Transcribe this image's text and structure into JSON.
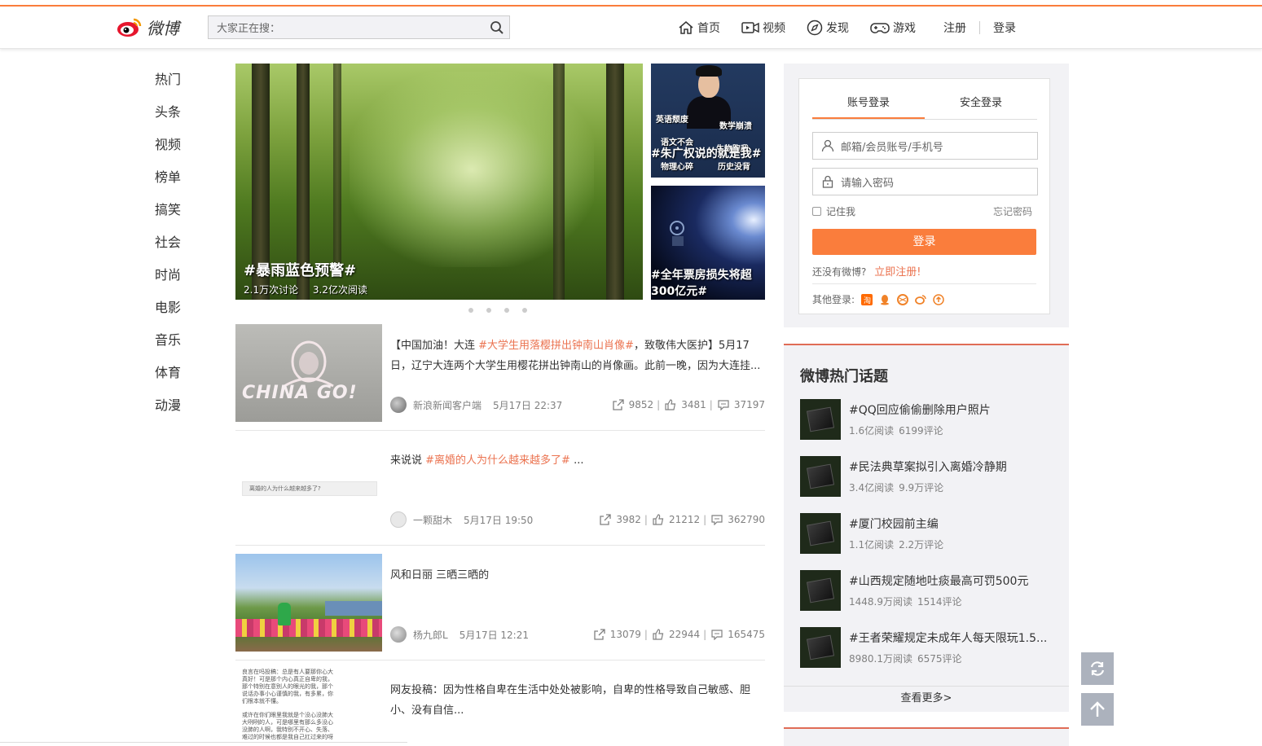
{
  "brand": {
    "name": "微博",
    "accent": "#fa7d3c",
    "link_color": "#eb7350"
  },
  "search": {
    "placeholder": "大家正在搜：",
    "icon": "search-icon"
  },
  "topnav": {
    "items": [
      {
        "label": "首页",
        "icon": "home-icon"
      },
      {
        "label": "视频",
        "icon": "video-icon"
      },
      {
        "label": "发现",
        "icon": "compass-icon"
      },
      {
        "label": "游戏",
        "icon": "gamepad-icon"
      }
    ],
    "register": "注册",
    "login": "登录"
  },
  "leftnav": [
    "热门",
    "头条",
    "视频",
    "榜单",
    "搞笑",
    "社会",
    "时尚",
    "电影",
    "音乐",
    "体育",
    "动漫"
  ],
  "banner": {
    "main_title": "#暴雨蓝色预警#",
    "main_discuss": "2.1万次讨论",
    "main_read": "3.2亿次阅读",
    "side1_title": "#朱广权说的就是我#",
    "side1_words": [
      "英语颓废",
      "数学崩溃",
      "语文不会",
      "生物跑我",
      "物理心碎",
      "历史没背"
    ],
    "side2_title": "#全年票房损失将超300亿元#"
  },
  "feed": [
    {
      "text_prefix": "【中国加油！大连 ",
      "tag": "#大学生用落樱拼出钟南山肖像#",
      "text_suffix": "，致敬伟大医护】5月17日，辽宁大连两个大学生用樱花拼出钟南山的肖像画。此前一晚，因为大连挂...",
      "thumb_text": "CHINA GO!",
      "author": "新浪新闻客户端",
      "time": "5月17日 22:37",
      "shares": "9852",
      "likes": "3481",
      "comments": "37197"
    },
    {
      "text_prefix": "来说说 ",
      "tag": "#离婚的人为什么越来越多了#",
      "text_suffix": " ...",
      "thumb_text": "离婚的人为什么越来越多了?",
      "author": "一颗甜木",
      "time": "5月17日 19:50",
      "shares": "3982",
      "likes": "21212",
      "comments": "362790"
    },
    {
      "text_prefix": "风和日丽 三晒三晒的",
      "tag": "",
      "text_suffix": "",
      "author": "杨九郎L",
      "time": "5月17日 12:21",
      "shares": "13079",
      "likes": "22944",
      "comments": "165475"
    },
    {
      "text_prefix": "网友投稿：因为性格自卑在生活中处处被影响，自卑的性格导致自己敏感、胆小、没有自信...",
      "tag": "",
      "text_suffix": "",
      "thumb_lines": [
        "良言在吗投稿：总是有人要那你心大",
        "真好！可是那个内心真正自卑的我，",
        "那个特别在意别人的眼光的我，那个",
        "说话办事小心谨慎的我，有多累，你",
        "们根本就不懂。",
        "或许在你们眼里我就是个没心没肺大",
        "大咧咧的人，可是哪里有那么多没心",
        "没肺的人啊，我特别不开心、失落、",
        "难过的时候也都是我自己扛过来的呀"
      ]
    }
  ],
  "login": {
    "tab_account": "账号登录",
    "tab_secure": "安全登录",
    "username_placeholder": "邮箱/会员账号/手机号",
    "password_placeholder": "请输入密码",
    "remember": "记住我",
    "forgot": "忘记密码",
    "submit": "登录",
    "no_account": "还没有微博?",
    "register_now": "立即注册!",
    "other_login": "其他登录:"
  },
  "hot": {
    "title": "微博热门话题",
    "items": [
      {
        "name": "#QQ回应偷偷删除用户照片",
        "reads": "1.6亿阅读",
        "comments": "6199评论"
      },
      {
        "name": "#民法典草案拟引入离婚冷静期",
        "reads": "3.4亿阅读",
        "comments": "9.9万评论"
      },
      {
        "name": "#厦门校园前主编",
        "reads": "1.1亿阅读",
        "comments": "2.2万评论"
      },
      {
        "name": "#山西规定随地吐痰最高可罚500元",
        "reads": "1448.9万阅读",
        "comments": "1514评论"
      },
      {
        "name": "#王者荣耀规定未成年人每天限玩1.5...",
        "reads": "8980.1万阅读",
        "comments": "6575评论"
      }
    ],
    "more": "查看更多>"
  }
}
